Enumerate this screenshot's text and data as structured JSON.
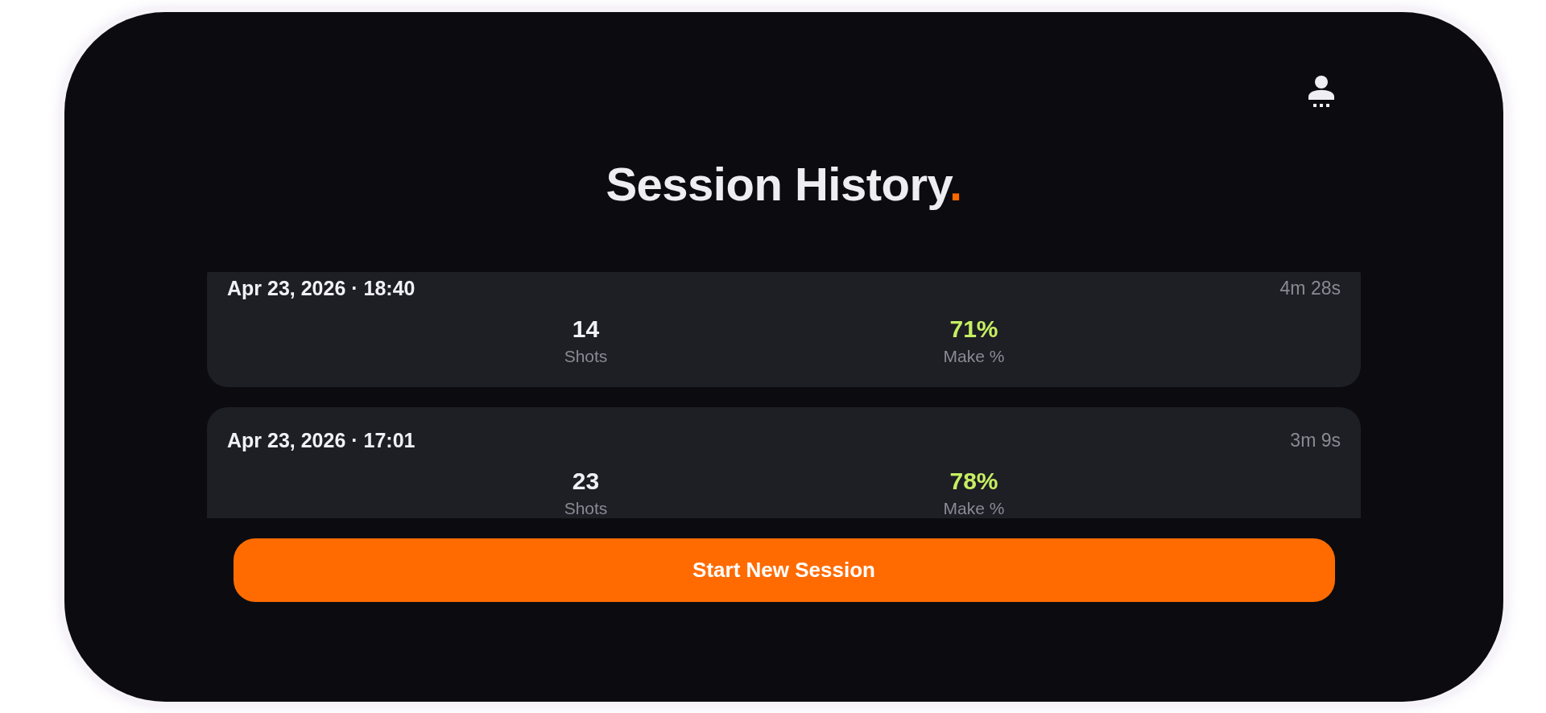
{
  "title": {
    "text": "Session History",
    "accent": "."
  },
  "sessions": [
    {
      "datetime": "Apr 23, 2026 · 18:40",
      "duration": "4m 28s",
      "stats": [
        {
          "kind": "count",
          "value": "14",
          "label": "Shots"
        },
        {
          "kind": "rate",
          "value": "71%",
          "label": "Make %"
        }
      ]
    },
    {
      "datetime": "Apr 23, 2026 · 17:01",
      "duration": "3m 9s",
      "stats": [
        {
          "kind": "count",
          "value": "23",
          "label": "Shots"
        },
        {
          "kind": "rate",
          "value": "78%",
          "label": "Make %"
        }
      ]
    }
  ],
  "primary_button": {
    "label": "Start New Session"
  }
}
